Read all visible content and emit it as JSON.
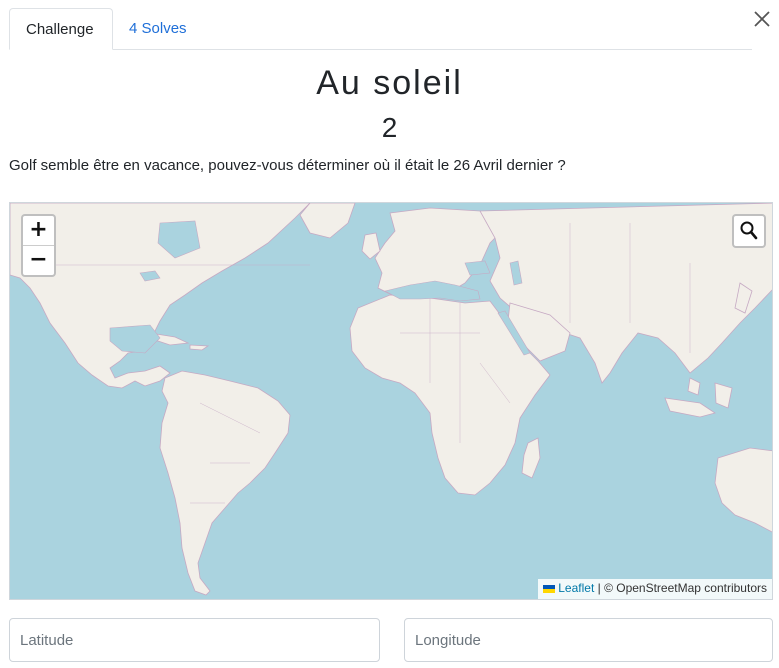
{
  "tabs": {
    "challenge_label": "Challenge",
    "solves_label": "4 Solves"
  },
  "challenge": {
    "title": "Au soleil",
    "value": "2",
    "description": "Golf semble être en vacance, pouvez-vous déterminer où il était le 26 Avril dernier ?"
  },
  "map": {
    "zoom_in": "+",
    "zoom_out": "−",
    "attribution_link": "Leaflet",
    "attribution_text": " | © OpenStreetMap contributors",
    "ocean_color": "#aad3df",
    "land_color": "#f2efe9",
    "border_color": "#c6a9c3"
  },
  "form": {
    "latitude_placeholder": "Latitude",
    "longitude_placeholder": "Longitude"
  },
  "icons": {
    "close": "close-icon",
    "search": "search-icon",
    "flag": "ukraine-flag-icon"
  }
}
